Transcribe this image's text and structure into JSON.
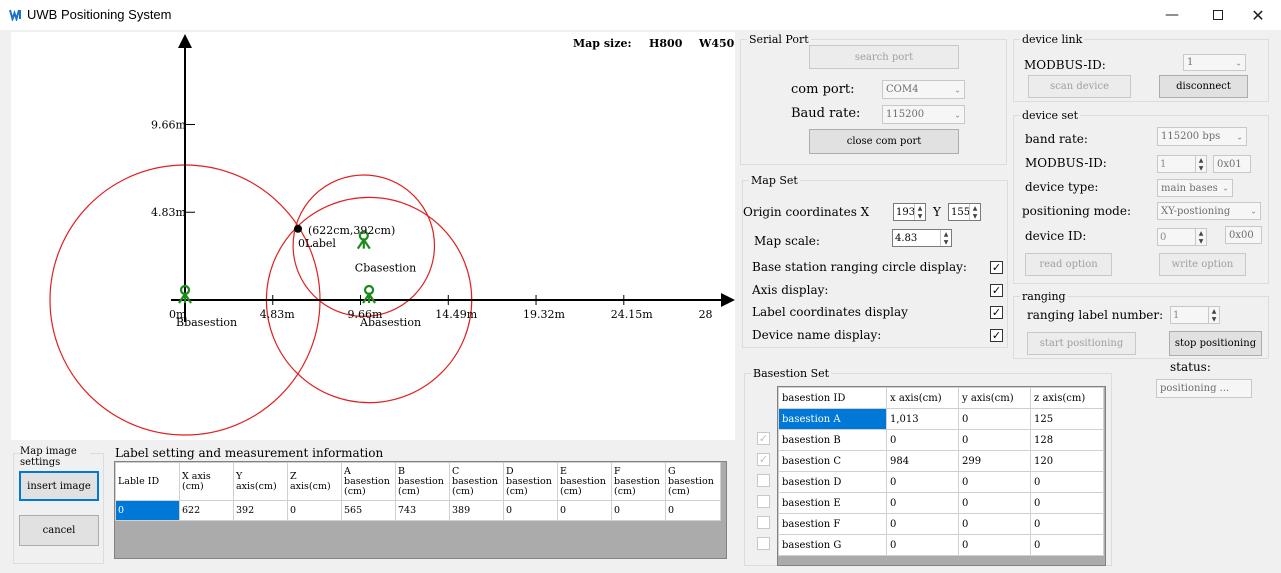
{
  "window": {
    "title": "UWB Positioning System",
    "minimize_icon": "minimize-icon",
    "maximize_icon": "maximize-icon",
    "close_icon": "close-icon"
  },
  "map": {
    "size_label": "Map size:",
    "height": "H800",
    "width": "W450",
    "x_ticks": [
      "0m",
      "4.83m",
      "9.66m",
      "14.49m",
      "19.32m",
      "24.15m",
      "28"
    ],
    "y_ticks": [
      "4.83m",
      "9.66m"
    ],
    "label_name": "0Label",
    "label_coord": "(622cm,392cm)",
    "stations": [
      {
        "name": "Abasestion",
        "x_cm": 1013,
        "y_cm": 0,
        "range_cm": 565
      },
      {
        "name": "Bbasestion",
        "x_cm": 0,
        "y_cm": 0,
        "range_cm": 743
      },
      {
        "name": "Cbasestion",
        "x_cm": 984,
        "y_cm": 299,
        "range_cm": 389
      }
    ],
    "circle_color": "#e02020",
    "station_color": "#1a8a1a"
  },
  "map_image": {
    "title": "Map image settings",
    "insert_label": "insert image",
    "cancel_label": "cancel"
  },
  "measure": {
    "title": "Label setting and measurement information",
    "headers": [
      "Lable ID",
      "X axis (cm)",
      "Y axis(cm)",
      "Z axis(cm)",
      "A basestion (cm)",
      "B basestion (cm)",
      "C basestion (cm)",
      "D basestion (cm)",
      "E basestion (cm)",
      "F basestion (cm)",
      "G basestion (cm)"
    ],
    "row": [
      "0",
      "622",
      "392",
      "0",
      "565",
      "743",
      "389",
      "0",
      "0",
      "0",
      "0"
    ]
  },
  "serial": {
    "title": "Serial Port",
    "search_label": "search port",
    "com_label": "com port:",
    "com_value": "COM4",
    "baud_label": "Baud rate:",
    "baud_value": "115200",
    "close_label": "close com port"
  },
  "link": {
    "title": "device link",
    "modbus_label": "MODBUS-ID:",
    "modbus_value": "1",
    "scan_label": "scan device",
    "disconnect_label": "disconnect"
  },
  "device_set": {
    "title": "device set",
    "band_label": "band rate:",
    "band_value": "115200 bps",
    "modbus_label": "MODBUS-ID:",
    "modbus_value": "1",
    "modbus_hex": "0x01",
    "type_label": "device type:",
    "type_value": "main bases",
    "mode_label": "positioning mode:",
    "mode_value": "XY-postioning",
    "id_label": "device ID:",
    "id_value": "0",
    "id_hex": "0x00",
    "read_label": "read option",
    "write_label": "write option"
  },
  "map_set": {
    "title": "Map Set",
    "origin_label": "Origin coordinates X",
    "origin_x": "193",
    "y_label": "Y",
    "origin_y": "155",
    "scale_label": "Map scale:",
    "scale_value": "4.83",
    "options": [
      {
        "label": "Base station ranging circle display:",
        "checked": true
      },
      {
        "label": "Axis display:",
        "checked": true
      },
      {
        "label": "Label coordinates display",
        "checked": true
      },
      {
        "label": "Device name display:",
        "checked": true
      }
    ]
  },
  "ranging": {
    "title": "ranging",
    "number_label": "ranging label number:",
    "number_value": "1",
    "start_label": "start positioning",
    "stop_label": "stop positioning",
    "status_label": "status:",
    "status_value": "positioning ..."
  },
  "basestion_set": {
    "title": "Basestion Set",
    "headers": [
      "basestion ID",
      "x axis(cm)",
      "y axis(cm)",
      "z axis(cm)"
    ],
    "rows": [
      {
        "id": "basestion A",
        "x": "1,013",
        "y": "0",
        "z": "125",
        "checked": false
      },
      {
        "id": "basestion B",
        "x": "0",
        "y": "0",
        "z": "128",
        "checked": true
      },
      {
        "id": "basestion C",
        "x": "984",
        "y": "299",
        "z": "120",
        "checked": true
      },
      {
        "id": "basestion D",
        "x": "0",
        "y": "0",
        "z": "0",
        "checked": false
      },
      {
        "id": "basestion E",
        "x": "0",
        "y": "0",
        "z": "0",
        "checked": false
      },
      {
        "id": "basestion F",
        "x": "0",
        "y": "0",
        "z": "0",
        "checked": false
      },
      {
        "id": "basestion G",
        "x": "0",
        "y": "0",
        "z": "0",
        "checked": false
      }
    ]
  }
}
